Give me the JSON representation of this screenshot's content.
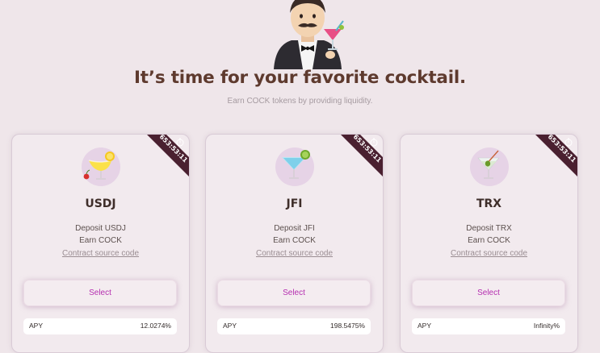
{
  "hero": {
    "mascot_icon": "man-in-tuxedo-with-cocktail",
    "title": "It’s time for your favorite cocktail.",
    "subtitle": "Earn COCK tokens by providing liquidity."
  },
  "pools": [
    {
      "icon": "tropical-drink-icon",
      "timer": "653:53:11",
      "token": "USDJ",
      "deposit_text": "Deposit USDJ",
      "earn_text": "Earn COCK",
      "contract_link": "Contract source code",
      "select_label": "Select",
      "apy_label": "APY",
      "apy_value": "12.0274%"
    },
    {
      "icon": "cocktail-glass-icon",
      "timer": "653:53:11",
      "token": "JFI",
      "deposit_text": "Deposit JFI",
      "earn_text": "Earn COCK",
      "contract_link": "Contract source code",
      "select_label": "Select",
      "apy_label": "APY",
      "apy_value": "198.5475%"
    },
    {
      "icon": "martini-icon",
      "timer": "653:53:11",
      "token": "TRX",
      "deposit_text": "Deposit TRX",
      "earn_text": "Earn COCK",
      "contract_link": "Contract source code",
      "select_label": "Select",
      "apy_label": "APY",
      "apy_value": "Infinity%"
    }
  ],
  "colors": {
    "background": "#efe6ea",
    "title": "#5e3a2e",
    "ribbon": "#4a2030",
    "select_text": "#b52fb0"
  }
}
